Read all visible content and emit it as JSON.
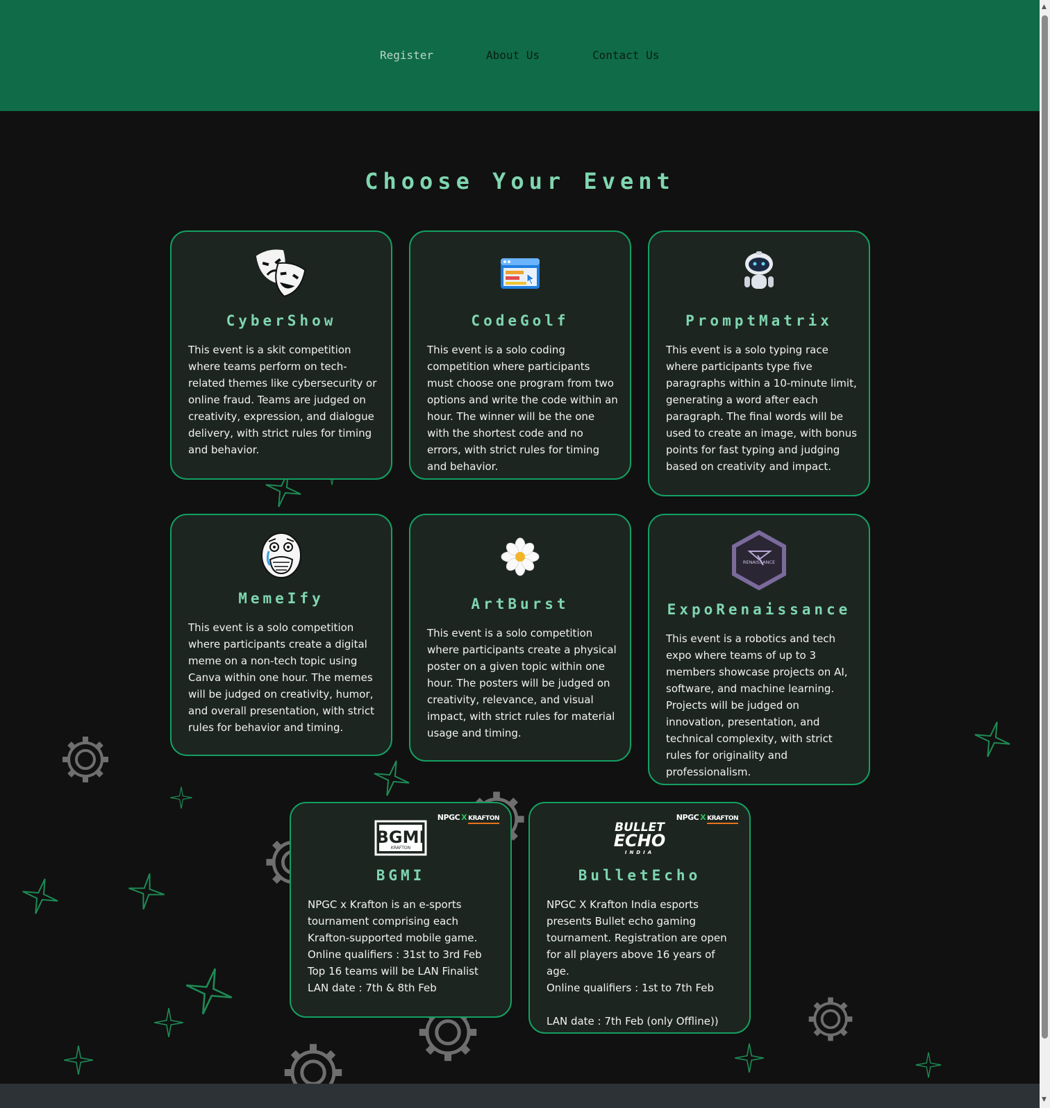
{
  "nav": {
    "items": [
      {
        "label": "Register"
      },
      {
        "label": "About Us"
      },
      {
        "label": "Contact Us"
      }
    ]
  },
  "page": {
    "title": "Choose Your Event"
  },
  "events": [
    {
      "name": "CyberShow",
      "icon": "theater-masks-icon",
      "description": "This event is a skit competition where teams perform on tech-related themes like cybersecurity or online fraud. Teams are judged on creativity, expression, and dialogue delivery, with strict rules for timing and behavior."
    },
    {
      "name": "CodeGolf",
      "icon": "browser-window-icon",
      "description": "This event is a solo coding competition where participants must choose one program from two options and write the code within an hour. The winner will be the one with the shortest code and no errors, with strict rules for timing and behavior."
    },
    {
      "name": "PromptMatrix",
      "icon": "robot-icon",
      "description": "This event is a solo typing race where participants type five paragraphs within a 10-minute limit, generating a word after each paragraph. The final words will be used to create an image, with bonus points for fast typing and judging based on creativity and impact."
    },
    {
      "name": "MemeIfy",
      "icon": "rage-face-icon",
      "description": "This event is a solo competition where participants create a digital meme on a non-tech topic using Canva within one hour. The memes will be judged on creativity, humor, and overall presentation, with strict rules for behavior and timing."
    },
    {
      "name": "ArtBurst",
      "icon": "daisy-flower-icon",
      "description": "This event is a solo competition where participants create a physical poster on a given topic within one hour. The posters will be judged on creativity, relevance, and visual impact, with strict rules for material usage and timing."
    },
    {
      "name": "ExpoRenaissance",
      "icon": "renaissance-logo-icon",
      "logo_text": "RENAISSANCE",
      "description": "This event is a robotics and tech expo where teams of up to 3 members showcase projects on AI, software, and machine learning. Projects will be judged on innovation, presentation, and technical complexity, with strict rules for originality and professionalism."
    },
    {
      "name": "BGMI",
      "icon": "bgmi-logo-icon",
      "logo_text": "BGMI",
      "logo_subtext": "KRAFTON",
      "sponsor": {
        "left": "NPGC",
        "x": "X",
        "right": "KRAFTON"
      },
      "lines": [
        "NPGC x Krafton is an e-sports tournament comprising each Krafton-supported mobile game.",
        "Online qualifiers : 31st to 3rd Feb",
        "Top 16 teams will be LAN Finalist",
        "LAN date : 7th & 8th Feb"
      ]
    },
    {
      "name": "BulletEcho",
      "icon": "bullet-echo-logo-icon",
      "logo_text": "BULLET",
      "logo_text2": "ECHO",
      "logo_subtext": "INDIA",
      "sponsor": {
        "left": "NPGC",
        "x": "X",
        "right": "KRAFTON"
      },
      "lines": [
        "NPGC X Krafton India esports presents Bullet echo gaming tournament. Registration are open for all players above 16 years of age.",
        "Online qualifiers : 1st to 7th Feb",
        " ",
        "LAN date : 7th Feb (only Offline))"
      ]
    }
  ],
  "colors": {
    "header_bg": "#0f6b48",
    "page_bg": "#111111",
    "card_bg": "#1d2520",
    "card_border": "#14a063",
    "accent_text": "#7fd6b0"
  }
}
